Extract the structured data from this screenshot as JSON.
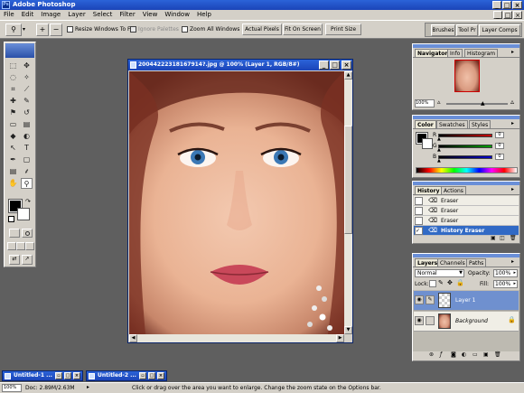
{
  "app": {
    "title": "Adobe Photoshop"
  },
  "menu": [
    "File",
    "Edit",
    "Image",
    "Layer",
    "Select",
    "Filter",
    "View",
    "Window",
    "Help"
  ],
  "options": {
    "resize_windows": "Resize Windows To Fit",
    "ignore_palettes": "Ignore Palettes",
    "zoom_all": "Zoom All Windows",
    "actual_pixels": "Actual Pixels",
    "fit_on_screen": "Fit On Screen",
    "print_size": "Print Size"
  },
  "palette_well": [
    "Brushes",
    "Tool Pr",
    "Layer Comps"
  ],
  "document": {
    "title": "20044222318167914?.jpg @ 100% (Layer 1, RGB/8#)"
  },
  "navigator": {
    "tabs": [
      "Navigator",
      "Info",
      "Histogram"
    ],
    "zoom": "100%"
  },
  "color": {
    "tabs": [
      "Color",
      "Swatches",
      "Styles"
    ],
    "channels": [
      {
        "label": "R",
        "value": "0",
        "color": "#cc0000"
      },
      {
        "label": "G",
        "value": "0",
        "color": "#00a000"
      },
      {
        "label": "B",
        "value": "0",
        "color": "#0000cc"
      }
    ]
  },
  "history": {
    "tabs": [
      "History",
      "Actions"
    ],
    "items": [
      "Eraser",
      "Eraser",
      "Eraser",
      "History Eraser"
    ],
    "selected_index": 3
  },
  "layers": {
    "tabs": [
      "Layers",
      "Channels",
      "Paths"
    ],
    "blend_mode": "Normal",
    "opacity_label": "Opacity:",
    "opacity": "100%",
    "lock_label": "Lock:",
    "fill_label": "Fill:",
    "fill": "100%",
    "items": [
      {
        "name": "Layer 1",
        "selected": true
      },
      {
        "name": "Background",
        "selected": false
      }
    ]
  },
  "taskbar": {
    "windows": [
      "Untitled-1 ...",
      "Untitled-2 ..."
    ]
  },
  "status": {
    "zoom": "100%",
    "doc": "Doc: 2.89M/2.63M",
    "hint": "Click or drag over the area you want to enlarge. Change the zoom state on the Options bar."
  },
  "colors": {
    "accent": "#316ac5",
    "title_blue": "#1f4fc4",
    "workspace": "#5f5f5f"
  }
}
